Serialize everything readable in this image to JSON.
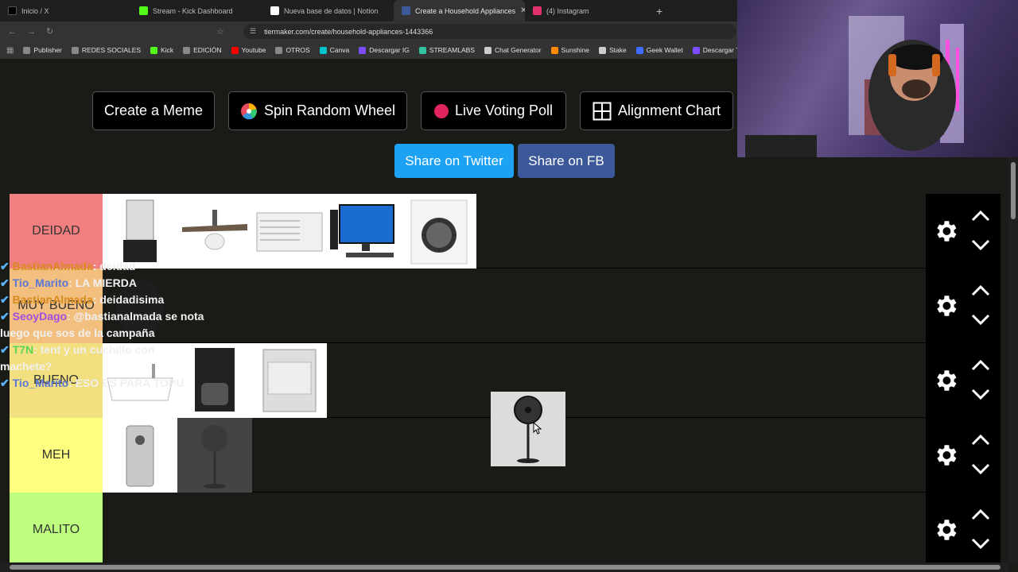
{
  "browser": {
    "tabs": [
      {
        "label": "Inicio / X",
        "color": "#000000"
      },
      {
        "label": "Stream - Kick Dashboard",
        "color": "#53fc18"
      },
      {
        "label": "Nueva base de datos | Notion",
        "color": "#ffffff"
      },
      {
        "label": "Create a Household Appliances",
        "color": "#3b5998",
        "active": true
      },
      {
        "label": "(4) Instagram",
        "color": "#e1306c"
      }
    ],
    "new_tab": "+",
    "tab_close": "✕",
    "url": "tiermaker.com/create/household-appliances-1443366",
    "bookmarks": [
      {
        "label": "Publisher",
        "color": "#888888"
      },
      {
        "label": "REDES SOCIALES",
        "color": "#888888"
      },
      {
        "label": "Kick",
        "color": "#53fc18"
      },
      {
        "label": "EDICIÓN",
        "color": "#888888"
      },
      {
        "label": "Youtube",
        "color": "#ff0000"
      },
      {
        "label": "OTROS",
        "color": "#888888"
      },
      {
        "label": "Canva",
        "color": "#00c4cc"
      },
      {
        "label": "Descargar IG",
        "color": "#7c4dff"
      },
      {
        "label": "STREAMLABS",
        "color": "#31c3a2"
      },
      {
        "label": "Chat Generator",
        "color": "#cccccc"
      },
      {
        "label": "Sunshine",
        "color": "#ff8a00"
      },
      {
        "label": "Stake",
        "color": "#cccccc"
      },
      {
        "label": "Geek Wallet",
        "color": "#3d6cff"
      },
      {
        "label": "Descargar TT",
        "color": "#7c4dff"
      }
    ]
  },
  "toolbar": {
    "meme": "Create a Meme",
    "wheel": "Spin Random Wheel",
    "poll": "Live Voting Poll",
    "alignment": "Alignment Chart",
    "share_twitter": "Share on Twitter",
    "share_fb": "Share on FB"
  },
  "tiers": [
    {
      "label": "DEIDAD",
      "color": "#f27f7f",
      "items": [
        "blender",
        "ceiling-fan",
        "air-conditioner",
        "desktop-computer",
        "washing-machine"
      ]
    },
    {
      "label": "MUY BUENO",
      "color": "#f2bf7f",
      "items": [
        "air-fryer"
      ]
    },
    {
      "label": "BUENO",
      "color": "#f2df7f",
      "items": [
        "bathtub",
        "coffee-maker",
        "dishwasher"
      ]
    },
    {
      "label": "MEH",
      "color": "#ffff7f",
      "items": [
        "can-opener",
        "standing-fan-ghost"
      ]
    },
    {
      "label": "MALITO",
      "color": "#bfff7f",
      "items": []
    }
  ],
  "chat": [
    {
      "user": "BastianAlmada",
      "text": ": deidad",
      "user_color": "#d98a1c"
    },
    {
      "user": "Tio_Marito",
      "text": ": LA MIERDA",
      "user_color": "#5b78d6"
    },
    {
      "user": "BastianAlmada",
      "text": ": deidadisima",
      "user_color": "#d98a1c"
    },
    {
      "user": "SeoyDago",
      "text": ": @bastianalmada se nota",
      "user_color": "#a050e0"
    },
    {
      "user": "",
      "text": "luego que sos de la campaña",
      "user_color": "#ffffff"
    },
    {
      "user": "T7N",
      "text": ": tent y un cuchillo con",
      "user_color": "#5bd65b"
    },
    {
      "user": "",
      "text": "machete?",
      "user_color": "#ffffff"
    },
    {
      "user": "Tio_Marito",
      "text": ": ESO ES PARA TOPU",
      "user_color": "#5b78d6"
    }
  ]
}
